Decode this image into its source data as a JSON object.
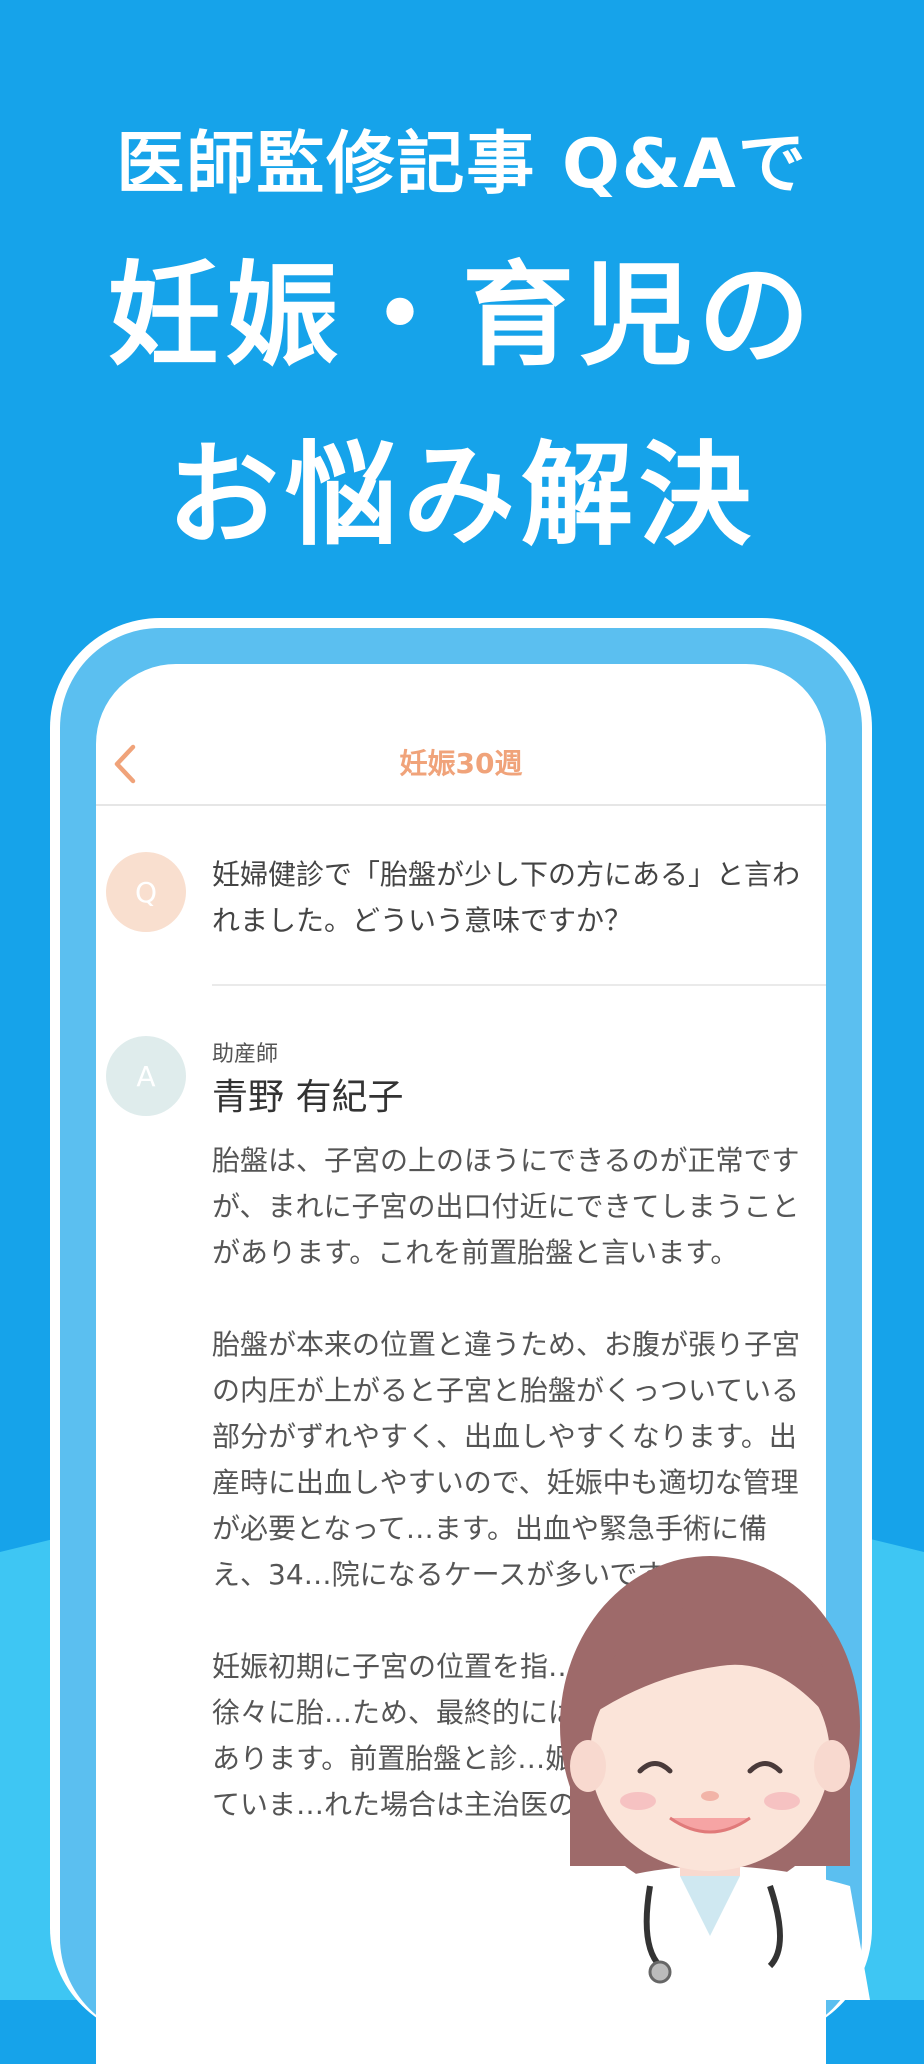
{
  "headline": {
    "sub": "医師監修記事 Q&Aで",
    "line1": "妊娠・育児の",
    "line2": "お悩み解決"
  },
  "nav": {
    "title": "妊娠30週",
    "back_icon": "chevron-left-icon"
  },
  "question": {
    "badge": "Q",
    "text": "妊婦健診で「胎盤が少し下の方にある」と言われました。どういう意味ですか？"
  },
  "answer": {
    "badge": "A",
    "role": "助産師",
    "name": "青野 有紀子",
    "paragraphs": [
      "胎盤は、子宮の上のほうにできるのが正常ですが、まれに子宮の出口付近にできてしまうことがあります。これを前置胎盤と言います。",
      "胎盤が本来の位置と違うため、お腹が張り子宮の内圧が上がると子宮と胎盤がくっついている部分がずれやすく、出血しやすくなります。出産時に出血しやすいので、妊娠中も適切な管理が必要となって…ます。出血や緊急手術に備え、34…院になるケースが多いです",
      "妊娠初期に子宮の位置を指…宮が大きくなると徐々に胎…ため、最終的には前置胎盤でな…もあります。前置胎盤と診…娠31週頃といわれていま…れた場合は主治医の指示"
    ]
  },
  "colors": {
    "background": "#16a3ea",
    "accent": "#f0a37a",
    "phone_frame": "#5bbff0"
  },
  "illustration": "doctor-character"
}
